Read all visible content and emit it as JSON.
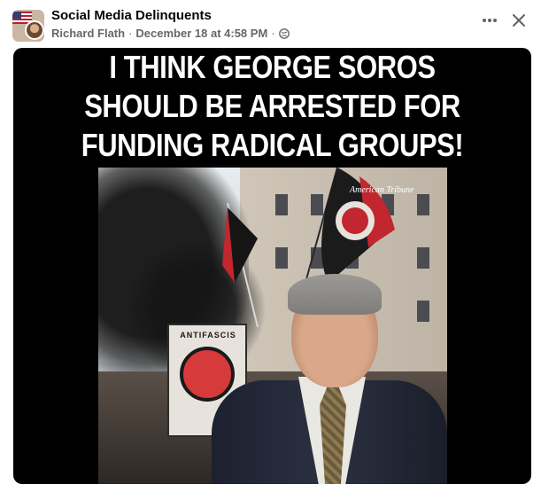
{
  "post": {
    "group_name": "Social Media Delinquents",
    "author": "Richard Flath",
    "separator": "·",
    "timestamp": "December 18 at 4:58 PM",
    "separator2": "·",
    "audience_icon": "globe-icon"
  },
  "actions": {
    "more_icon": "more-horizontal-icon",
    "close_icon": "close-icon"
  },
  "meme": {
    "caption_lines": [
      "I THINK GEORGE SOROS",
      "SHOULD BE ARRESTED FOR",
      "FUNDING RADICAL GROUPS!"
    ],
    "watermark": "American    Tribune",
    "sign_text": "ANTIFASCIS"
  },
  "colors": {
    "group_name": "#050505",
    "meta": "#65676b",
    "media_background": "#000000",
    "caption": "#ffffff"
  }
}
